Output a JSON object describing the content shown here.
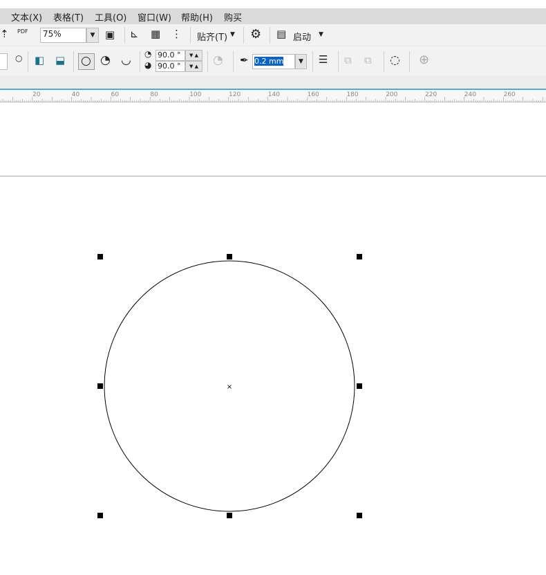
{
  "menu": [
    "文本(X)",
    "表格(T)",
    "工具(O)",
    "窗口(W)",
    "帮助(H)",
    "购买"
  ],
  "toolbar": {
    "zoom": "75%",
    "snap": "贴齐(T)",
    "launch": "启动",
    "pdf": "PDF"
  },
  "props": {
    "start_angle": "90.0 °",
    "end_angle": "90.0 °",
    "outline_width": "0.2 mm"
  },
  "ruler": [
    "20",
    "40",
    "60",
    "80",
    "100",
    "120",
    "140",
    "160",
    "180",
    "200",
    "220",
    "240",
    "260"
  ],
  "colors": {
    "accent": "#0a64c8",
    "ruler_line": "#5aa7c8"
  }
}
